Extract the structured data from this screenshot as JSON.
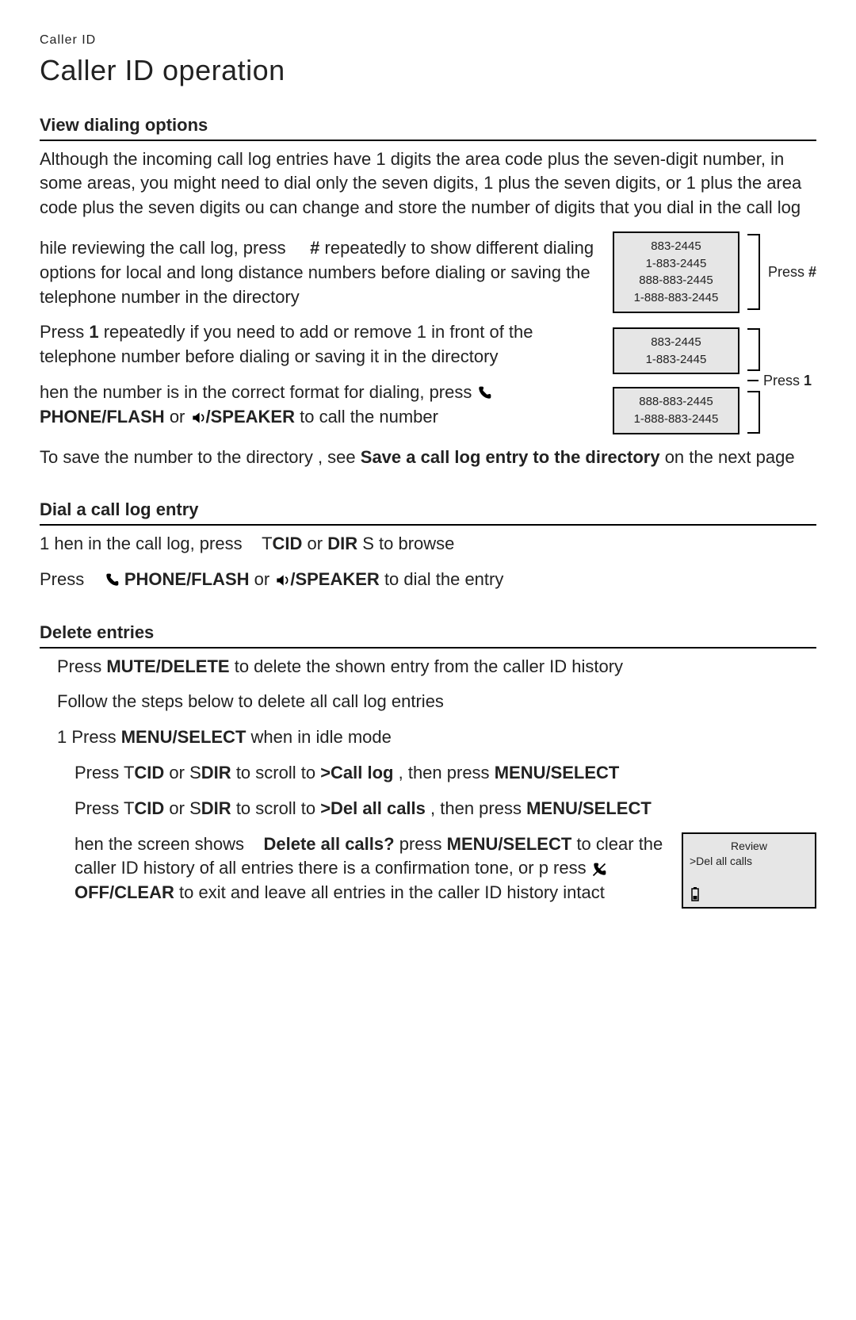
{
  "crumb": "Caller ID",
  "title": "Caller ID operation",
  "sections": {
    "view_heading": "View dialing options",
    "view_p1": "Although the incoming call log entries have 1 digits the area code plus the seven-digit number, in some areas, you might need to dial only the seven digits, 1 plus the seven digits, or 1 plus the area code plus the seven digits ou  can change and store the number of digits that you dial in the call log",
    "view_p2a": "hile reviewing the call log, press ",
    "view_p2b_key": "#",
    "view_p2c": " repeatedly to show different dialing options for local and long distance numbers before dialing or saving the telephone number in the directory",
    "view_p3a": "Press ",
    "view_p3_key": "1",
    "view_p3b": " repeatedly if you need to add or remove 1 in front of the telephone number before dialing or saving it in the directory",
    "view_p4a": "hen the number  is in the correct format for dialing, press ",
    "phone_flash": "PHONE/FLASH",
    "or": " or ",
    "speaker": "/SPEAKER",
    "view_p4b": " to call the number",
    "view_p5a": "To save the number to the directory , see ",
    "save_ref": "Save a call log entry to the directory",
    "view_p5b": " on the next page",
    "dial_heading": "Dial a call log entry",
    "dial_l1a": "1 hen in the call log, press ",
    "dial_l1_cid_pre": "T",
    "dial_l1_cid": "CID",
    "dial_l1_mid": " or ",
    "dial_l1_dir": "DIR",
    "dial_l1_dir_suf": " S",
    "dial_l1b": " to browse",
    "dial_l2a": " Press ",
    "dial_l2b": " to dial the entry",
    "del_heading": "Delete entries",
    "del_l1a": " Press ",
    "mute_delete": "MUTE/DELETE",
    "del_l1b": " to delete the shown entry from the caller ID history",
    "del_l2": " Follow the steps below to delete  all call log entries",
    "del_s1a": "1 Press ",
    "menu_select": "MENU/SELECT",
    "menu_select_sc": "MENU/SELECT",
    "del_s1b": " when in idle mode",
    "del_s2a": " Press ",
    "del_s2_mid": " to scroll to ",
    "call_log": ">Call log",
    "del_s2b": ", then press ",
    "del_s3_target": ">Del all calls",
    "del_s4a": " hen the screen shows ",
    "del_all_q": "Delete all calls?",
    "del_s4b": " press ",
    "del_s4c": " to clear the caller ID history of all entries there is a confirmation tone, or p  ress ",
    "off_clear": "OFF/CLEAR",
    "del_s4d": " to exit and leave all entries in the caller ID history intact"
  },
  "figures": {
    "box_hash": [
      "883-2445",
      "1-883-2445",
      "888-883-2445",
      "1-888-883-2445"
    ],
    "label_hash_a": "Press ",
    "label_hash_b": "#",
    "box_one_top": [
      "883-2445",
      "1-883-2445"
    ],
    "box_one_bot": [
      "888-883-2445",
      "1-888-883-2445"
    ],
    "label_one_a": "Press ",
    "label_one_b": "1",
    "screen2_line1": "Review",
    "screen2_line2": ">Del all calls"
  },
  "icons": {
    "phone": "phone-icon",
    "speaker": "speaker-icon",
    "cancel": "cancel-icon",
    "battery": "battery-icon"
  }
}
